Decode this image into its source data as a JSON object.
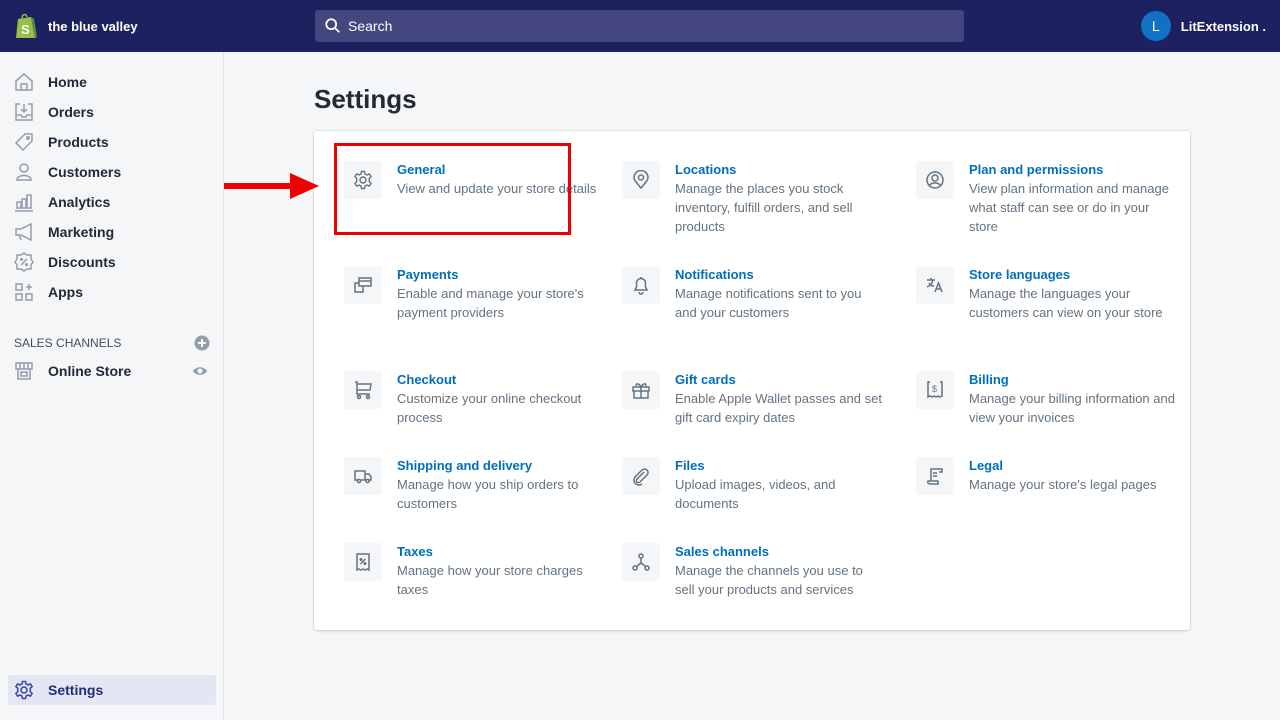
{
  "topbar": {
    "store_name": "the blue valley",
    "search_placeholder": "Search",
    "user_initial": "L",
    "user_name": "LitExtension .",
    "colors": {
      "bar": "#1c2260",
      "search": "#43467f",
      "avatar": "#1172c4",
      "logo": "#95bf47"
    }
  },
  "sidebar": {
    "items": [
      {
        "label": "Home",
        "icon": "home-icon"
      },
      {
        "label": "Orders",
        "icon": "orders-icon"
      },
      {
        "label": "Products",
        "icon": "tag-icon"
      },
      {
        "label": "Customers",
        "icon": "customer-icon"
      },
      {
        "label": "Analytics",
        "icon": "bar-chart-icon"
      },
      {
        "label": "Marketing",
        "icon": "megaphone-icon"
      },
      {
        "label": "Discounts",
        "icon": "discount-icon"
      },
      {
        "label": "Apps",
        "icon": "apps-icon"
      }
    ],
    "sales_channels_label": "SALES CHANNELS",
    "channels": [
      {
        "label": "Online Store",
        "icon": "store-icon"
      }
    ],
    "settings_label": "Settings"
  },
  "main": {
    "title": "Settings",
    "settings": [
      {
        "title": "General",
        "description": "View and update your store details",
        "icon": "gear-icon"
      },
      {
        "title": "Locations",
        "description": "Manage the places you stock inventory, fulfill orders, and sell products",
        "icon": "location-pin-icon"
      },
      {
        "title": "Plan and permissions",
        "description": "View plan information and manage what staff can see or do in your store",
        "icon": "user-circle-icon"
      },
      {
        "title": "Payments",
        "description": "Enable and manage your store's payment providers",
        "icon": "payment-cards-icon"
      },
      {
        "title": "Notifications",
        "description": "Manage notifications sent to you and your customers",
        "icon": "bell-icon"
      },
      {
        "title": "Store languages",
        "description": "Manage the languages your customers can view on your store",
        "icon": "translate-icon"
      },
      {
        "title": "Checkout",
        "description": "Customize your online checkout process",
        "icon": "cart-icon"
      },
      {
        "title": "Gift cards",
        "description": "Enable Apple Wallet passes and set gift card expiry dates",
        "icon": "gift-icon"
      },
      {
        "title": "Billing",
        "description": "Manage your billing information and view your invoices",
        "icon": "billing-receipt-icon"
      },
      {
        "title": "Shipping and delivery",
        "description": "Manage how you ship orders to customers",
        "icon": "truck-icon"
      },
      {
        "title": "Files",
        "description": "Upload images, videos, and documents",
        "icon": "paperclip-icon"
      },
      {
        "title": "Legal",
        "description": "Manage your store's legal pages",
        "icon": "legal-scroll-icon"
      },
      {
        "title": "Taxes",
        "description": "Manage how your store charges taxes",
        "icon": "tax-receipt-icon"
      },
      {
        "title": "Sales channels",
        "description": "Manage the channels you use to sell your products and services",
        "icon": "sales-channels-icon"
      }
    ],
    "annotation": {
      "highlighted_item": "General",
      "color": "#ee0000"
    }
  }
}
